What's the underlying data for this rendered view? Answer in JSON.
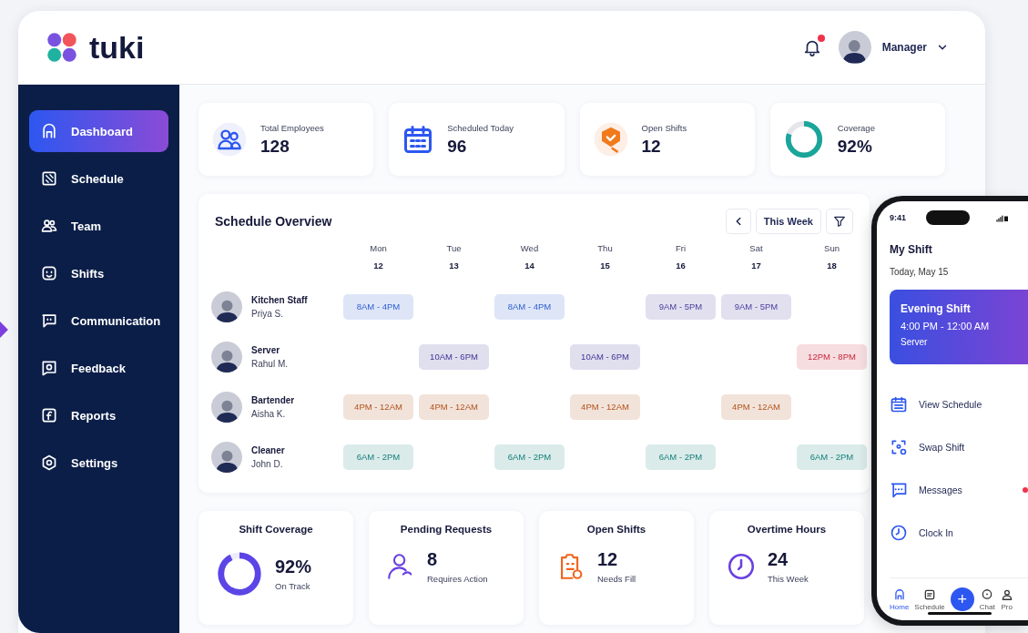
{
  "header": {
    "logo": "tuki",
    "notifications": {
      "unread": true
    },
    "user": {
      "name": "Manager"
    }
  },
  "sidebar": {
    "items": [
      {
        "label": "Dashboard",
        "selected": true
      },
      {
        "label": "Schedule",
        "selected": false
      },
      {
        "label": "Team",
        "selected": false
      },
      {
        "label": "Shifts",
        "selected": false
      },
      {
        "label": "Communication",
        "selected": false
      },
      {
        "label": "Feedback",
        "selected": false
      },
      {
        "label": "Reports",
        "selected": false
      },
      {
        "label": "Settings",
        "selected": false
      }
    ]
  },
  "stats": [
    {
      "kind": "icon",
      "label": "Total Employees",
      "value": "128"
    },
    {
      "kind": "icon",
      "label": "Scheduled Today",
      "value": "96"
    },
    {
      "kind": "icon",
      "label": "Open Shifts",
      "value": "12"
    },
    {
      "kind": "donut",
      "label": "Coverage",
      "value": "92%",
      "level": 0.8
    }
  ],
  "schedule": {
    "title": "Schedule Overview",
    "range": "This Week",
    "days": [
      {
        "name": "Mon",
        "date": "12"
      },
      {
        "name": "Tue",
        "date": "13"
      },
      {
        "name": "Wed",
        "date": "14"
      },
      {
        "name": "Thu",
        "date": "15"
      },
      {
        "name": "Fri",
        "date": "16"
      },
      {
        "name": "Sat",
        "date": "17"
      },
      {
        "name": "Sun",
        "date": "18"
      }
    ],
    "rows": [
      {
        "role": "Kitchen Staff",
        "name": "Priya S.",
        "shifts": {
          "mon": {
            "time": "8AM - 4PM",
            "color": "#2f5fd0"
          },
          "wed": {
            "time": "8AM - 4PM",
            "color": "#2f5fd0"
          },
          "fri": {
            "time": "9AM - 5PM",
            "color": "#4b3f9e"
          },
          "sat": {
            "time": "9AM - 5PM",
            "color": "#4b3f9e"
          }
        }
      },
      {
        "role": "Server",
        "name": "Rahul M.",
        "shifts": {
          "tue": {
            "time": "10AM - 6PM",
            "color": "#3c3596"
          },
          "thu": {
            "time": "10AM - 6PM",
            "color": "#3c3596"
          },
          "sun": {
            "time": "12PM - 8PM",
            "color": "#c8283c"
          }
        }
      },
      {
        "role": "Bartender",
        "name": "Aisha K.",
        "shifts": {
          "mon": {
            "time": "4PM - 12AM",
            "color": "#b0521a"
          },
          "tue": {
            "time": "4PM - 12AM",
            "color": "#b0521a"
          },
          "thu": {
            "time": "4PM - 12AM",
            "color": "#b0521a"
          },
          "sat": {
            "time": "4PM - 12AM",
            "color": "#b0521a"
          }
        }
      },
      {
        "role": "Cleaner",
        "name": "John D.",
        "shifts": {
          "mon": {
            "time": "6AM - 2PM",
            "color": "#16807a"
          },
          "wed": {
            "time": "6AM - 2PM",
            "color": "#16807a"
          },
          "fri": {
            "time": "6AM - 2PM",
            "color": "#16807a"
          },
          "sun": {
            "time": "6AM - 2PM",
            "color": "#16807a"
          }
        }
      }
    ]
  },
  "summary": [
    {
      "kind": "donut",
      "title": "Shift Coverage",
      "value": "92%",
      "note": "On Track",
      "level": 0.92
    },
    {
      "kind": "icon",
      "title": "Pending Requests",
      "value": "8",
      "note": "Requires Action"
    },
    {
      "kind": "icon",
      "title": "Open Shifts",
      "value": "12",
      "note": "Needs Fill"
    },
    {
      "kind": "icon",
      "title": "Overtime Hours",
      "value": "24",
      "note": "This Week"
    }
  ],
  "phone": {
    "time": "9:41",
    "title": "My Shift",
    "date": "Today, May 15",
    "shift": {
      "title": "Evening Shift",
      "hours": "4:00 PM - 12:00 AM",
      "role": "Server"
    },
    "actions": [
      {
        "label": "View Schedule",
        "unread": false
      },
      {
        "label": "Swap Shift",
        "unread": false
      },
      {
        "label": "Messages",
        "unread": true
      },
      {
        "label": "Clock In",
        "unread": false
      }
    ],
    "nav": [
      {
        "label": "Home",
        "selected": true
      },
      {
        "label": "Schedule",
        "selected": false
      },
      {
        "label": "+",
        "kind": "add",
        "selected": false
      },
      {
        "label": "Chat",
        "selected": false
      },
      {
        "label": "Pro",
        "selected": false
      }
    ]
  }
}
